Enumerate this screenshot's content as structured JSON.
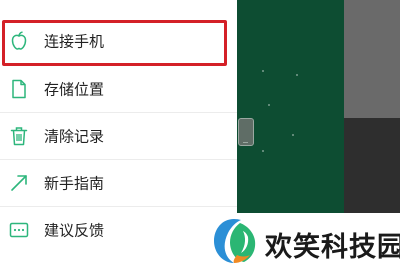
{
  "menu": {
    "items": [
      {
        "label": "连接手机",
        "icon": "apple-icon"
      },
      {
        "label": "存储位置",
        "icon": "document-icon"
      },
      {
        "label": "清除记录",
        "icon": "trash-icon"
      },
      {
        "label": "新手指南",
        "icon": "arrow-up-right-icon"
      },
      {
        "label": "建议反馈",
        "icon": "message-icon"
      }
    ],
    "highlighted_index": 0
  },
  "watermark": {
    "text": "欢笑科技园"
  },
  "colors": {
    "accent_green": "#2db67c",
    "highlight_red": "#d42027",
    "background_green": "#0d4d32"
  }
}
